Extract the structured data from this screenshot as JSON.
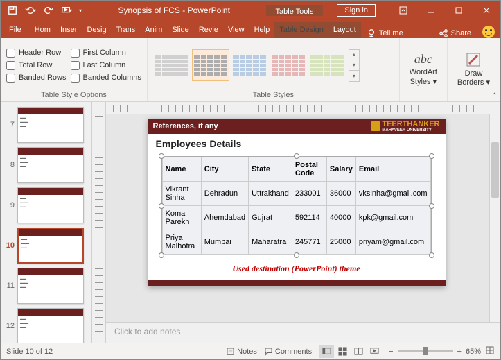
{
  "titlebar": {
    "title": "Synopsis of FCS  -  PowerPoint",
    "tooltabs": "Table Tools",
    "signin": "Sign in"
  },
  "tabs": {
    "file": "File",
    "list": [
      "Home",
      "Insert",
      "Design",
      "Transitions",
      "Animations",
      "Slide Show",
      "Review",
      "View",
      "Help"
    ],
    "context": [
      "Table Design",
      "Layout"
    ],
    "tellme": "Tell me",
    "share": "Share"
  },
  "ribbon": {
    "options": {
      "label": "Table Style Options",
      "header_row": "Header Row",
      "total_row": "Total Row",
      "banded_rows": "Banded Rows",
      "first_col": "First Column",
      "last_col": "Last Column",
      "banded_cols": "Banded Columns"
    },
    "styles": {
      "label": "Table Styles"
    },
    "wordart": {
      "label": "WordArt\nStyles",
      "icon": "abc"
    },
    "borders": {
      "label": "Draw\nBorders"
    }
  },
  "thumbs": [
    7,
    8,
    9,
    10,
    11,
    12
  ],
  "active_thumb": 10,
  "slide": {
    "ref": "References, if any",
    "uni": {
      "name": "TEERTHANKER",
      "sub": "MAHAVEER UNIVERSITY"
    },
    "title": "Employees Details",
    "headers": [
      "Name",
      "City",
      "State",
      "Postal Code",
      "Salary",
      "Email"
    ],
    "rows": [
      [
        "Vikrant Sinha",
        "Dehradun",
        "Uttrakhand",
        "233001",
        "36000",
        "vksinha@gmail.com"
      ],
      [
        "Komal Parekh",
        "Ahemdabad",
        "Gujrat",
        "592114",
        "40000",
        "kpk@gmail.com"
      ],
      [
        "Priya Malhotra",
        "Mumbai",
        "Maharatra",
        "245771",
        "25000",
        "priyam@gmail.com"
      ]
    ],
    "caption": "Used destination (PowerPoint) theme"
  },
  "chart_data": {
    "type": "table",
    "title": "Employees Details",
    "columns": [
      "Name",
      "City",
      "State",
      "Postal Code",
      "Salary",
      "Email"
    ],
    "rows": [
      {
        "Name": "Vikrant Sinha",
        "City": "Dehradun",
        "State": "Uttrakhand",
        "Postal Code": 233001,
        "Salary": 36000,
        "Email": "vksinha@gmail.com"
      },
      {
        "Name": "Komal Parekh",
        "City": "Ahemdabad",
        "State": "Gujrat",
        "Postal Code": 592114,
        "Salary": 40000,
        "Email": "kpk@gmail.com"
      },
      {
        "Name": "Priya Malhotra",
        "City": "Mumbai",
        "State": "Maharatra",
        "Postal Code": 245771,
        "Salary": 25000,
        "Email": "priyam@gmail.com"
      }
    ]
  },
  "notes": "Click to add notes",
  "status": {
    "slide": "Slide 10 of 12",
    "notes": "Notes",
    "comments": "Comments",
    "zoom": "65%"
  }
}
